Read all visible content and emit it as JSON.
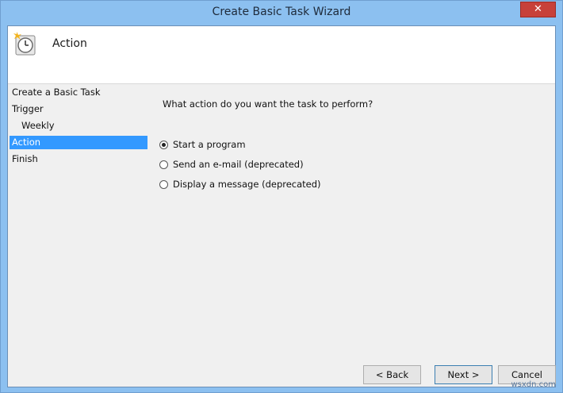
{
  "window": {
    "title": "Create Basic Task Wizard",
    "close_label": "✕"
  },
  "header": {
    "title": "Action",
    "icon": "clock-icon"
  },
  "nav": {
    "items": [
      {
        "label": "Create a Basic Task",
        "level": 0,
        "active": false
      },
      {
        "label": "Trigger",
        "level": 0,
        "active": false
      },
      {
        "label": "Weekly",
        "level": 1,
        "active": false
      },
      {
        "label": "Action",
        "level": 0,
        "active": true
      },
      {
        "label": "Finish",
        "level": 0,
        "active": false
      }
    ]
  },
  "main": {
    "prompt": "What action do you want the task to perform?",
    "options": [
      {
        "label": "Start a program",
        "checked": true
      },
      {
        "label": "Send an e-mail (deprecated)",
        "checked": false
      },
      {
        "label": "Display a message (deprecated)",
        "checked": false
      }
    ]
  },
  "buttons": {
    "back": "< Back",
    "next": "Next >",
    "cancel": "Cancel"
  },
  "watermark": "wsxdn.com",
  "colors": {
    "selection": "#3399ff",
    "titlebar": "#8cc0f0",
    "close": "#c7413a"
  }
}
